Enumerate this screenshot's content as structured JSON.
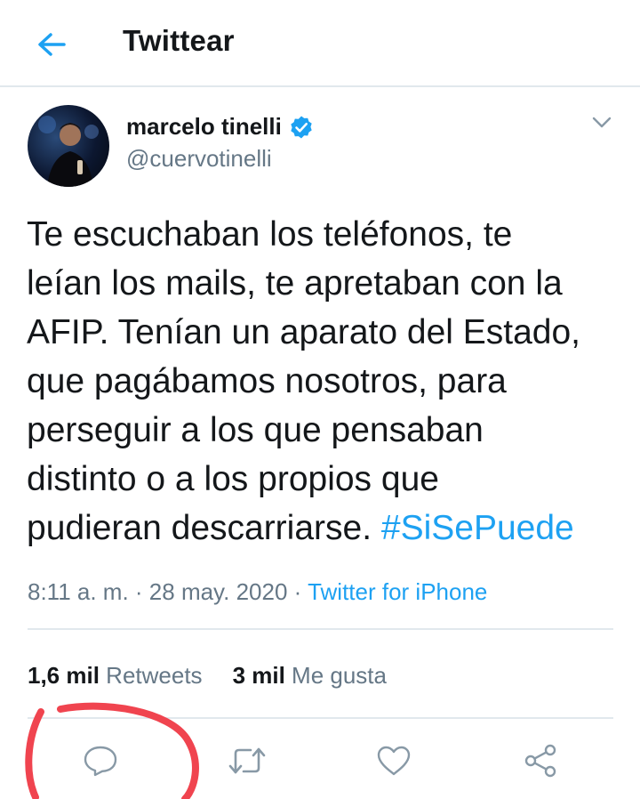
{
  "header": {
    "title": "Twittear",
    "back_icon": "arrow-left-icon"
  },
  "tweet": {
    "author": {
      "name": "marcelo tinelli",
      "handle": "@cuervotinelli",
      "verified": true
    },
    "text": "Te escuchaban los teléfonos, te\nleían los mails, te apretaban con la\nAFIP. Tenían un aparato del Estado,\nque pagábamos nosotros, para\nperseguir a los que pensaban\ndistinto o a los propios que\npudieran descarriarse. ",
    "hashtag": "#SiSePuede",
    "time": "8:11 a. m.",
    "separator": " · ",
    "date": "28 may. 2020",
    "source": "Twitter for iPhone"
  },
  "stats": {
    "retweets_count": "1,6 mil",
    "retweets_label": "Retweets",
    "likes_count": "3 mil",
    "likes_label": "Me gusta"
  },
  "actions": [
    {
      "icon": "reply-icon"
    },
    {
      "icon": "retweet-icon"
    },
    {
      "icon": "like-icon"
    },
    {
      "icon": "share-icon"
    }
  ],
  "colors": {
    "accent": "#1da1f2",
    "text": "#14171a",
    "secondary": "#657786",
    "divider": "#e1e8ed",
    "annotation": "#f0444f"
  }
}
